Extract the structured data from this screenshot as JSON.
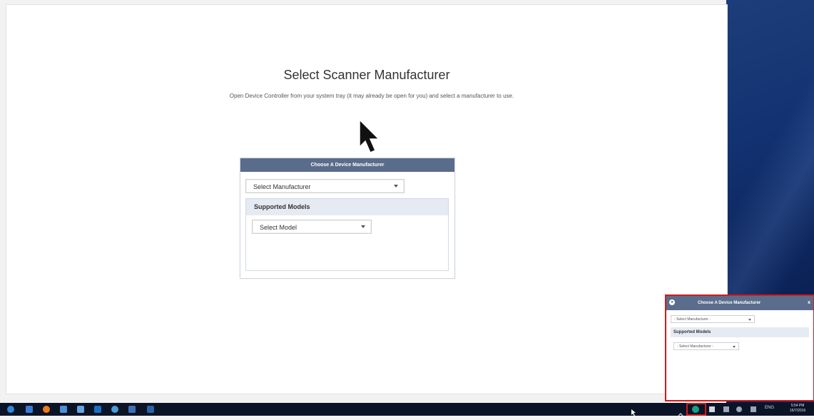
{
  "page": {
    "title": "Select Scanner Manufacturer",
    "subtitle": "Open Device Controller from your system tray (it may already be open for you) and select a manufacturer to use."
  },
  "panel": {
    "header": "Choose A Device Manufacturer",
    "manufacturer_select": "Select Manufacturer",
    "models_heading": "Supported Models",
    "model_select": "Select Model"
  },
  "tray_popup": {
    "header": "Choose A Device Manufacturer",
    "close": "x",
    "manufacturer_select": "- Select Manufacturer -",
    "models_heading": "Supported Models",
    "model_select": "- Select Manufacturer -"
  },
  "taskbar": {
    "apps": [
      "start-icon",
      "search-icon",
      "app-icon-1",
      "app-icon-2",
      "app-icon-3",
      "app-icon-4",
      "app-icon-5",
      "app-icon-6",
      "app-icon-7"
    ],
    "language": "ENG",
    "time": "5:54 PM",
    "date": "16/7/2016"
  },
  "colors": {
    "panel_header": "#5a6c8c",
    "highlight": "#d11a1a",
    "taskbar": "#0b1426"
  }
}
